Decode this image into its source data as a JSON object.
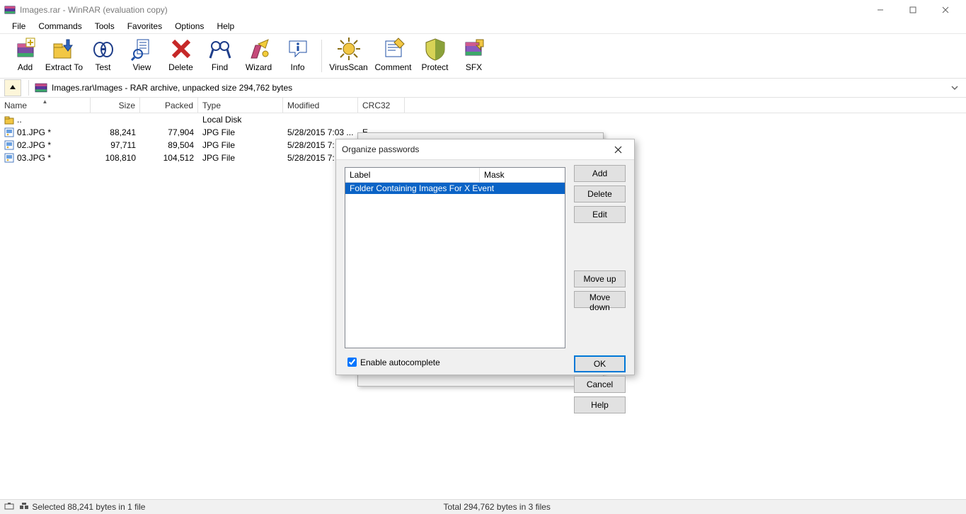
{
  "window": {
    "title": "Images.rar - WinRAR (evaluation copy)"
  },
  "menu": [
    "File",
    "Commands",
    "Tools",
    "Favorites",
    "Options",
    "Help"
  ],
  "toolbar": [
    {
      "id": "add",
      "label": "Add"
    },
    {
      "id": "extract",
      "label": "Extract To"
    },
    {
      "id": "test",
      "label": "Test"
    },
    {
      "id": "view",
      "label": "View"
    },
    {
      "id": "delete",
      "label": "Delete"
    },
    {
      "id": "find",
      "label": "Find"
    },
    {
      "id": "wizard",
      "label": "Wizard"
    },
    {
      "id": "info",
      "label": "Info"
    },
    {
      "id": "virus",
      "label": "VirusScan"
    },
    {
      "id": "comment",
      "label": "Comment"
    },
    {
      "id": "protect",
      "label": "Protect"
    },
    {
      "id": "sfx",
      "label": "SFX"
    }
  ],
  "path": "Images.rar\\Images - RAR archive, unpacked size 294,762 bytes",
  "columns": {
    "name": "Name",
    "size": "Size",
    "packed": "Packed",
    "type": "Type",
    "modified": "Modified",
    "crc": "CRC32"
  },
  "rows": [
    {
      "name": "..",
      "size": "",
      "packed": "",
      "type": "Local Disk",
      "modified": "",
      "crc": "",
      "icon": "folder"
    },
    {
      "name": "01.JPG *",
      "size": "88,241",
      "packed": "77,904",
      "type": "JPG File",
      "modified": "5/28/2015 7:03 ...",
      "crc": "E...",
      "icon": "img"
    },
    {
      "name": "02.JPG *",
      "size": "97,711",
      "packed": "89,504",
      "type": "JPG File",
      "modified": "5/28/2015 7:",
      "crc": "",
      "icon": "img"
    },
    {
      "name": "03.JPG *",
      "size": "108,810",
      "packed": "104,512",
      "type": "JPG File",
      "modified": "5/28/2015 7:",
      "crc": "",
      "icon": "img"
    }
  ],
  "status": {
    "left": "Selected 88,241 bytes in 1 file",
    "right": "Total 294,762 bytes in 3 files"
  },
  "dialog": {
    "title": "Organize passwords",
    "cols": {
      "label": "Label",
      "mask": "Mask"
    },
    "entry": "Folder Containing Images For X Event",
    "buttons": {
      "add": "Add",
      "delete": "Delete",
      "edit": "Edit",
      "moveup": "Move up",
      "movedown": "Move down",
      "ok": "OK",
      "cancel": "Cancel",
      "help": "Help"
    },
    "checkbox": "Enable autocomplete",
    "checked": true
  }
}
